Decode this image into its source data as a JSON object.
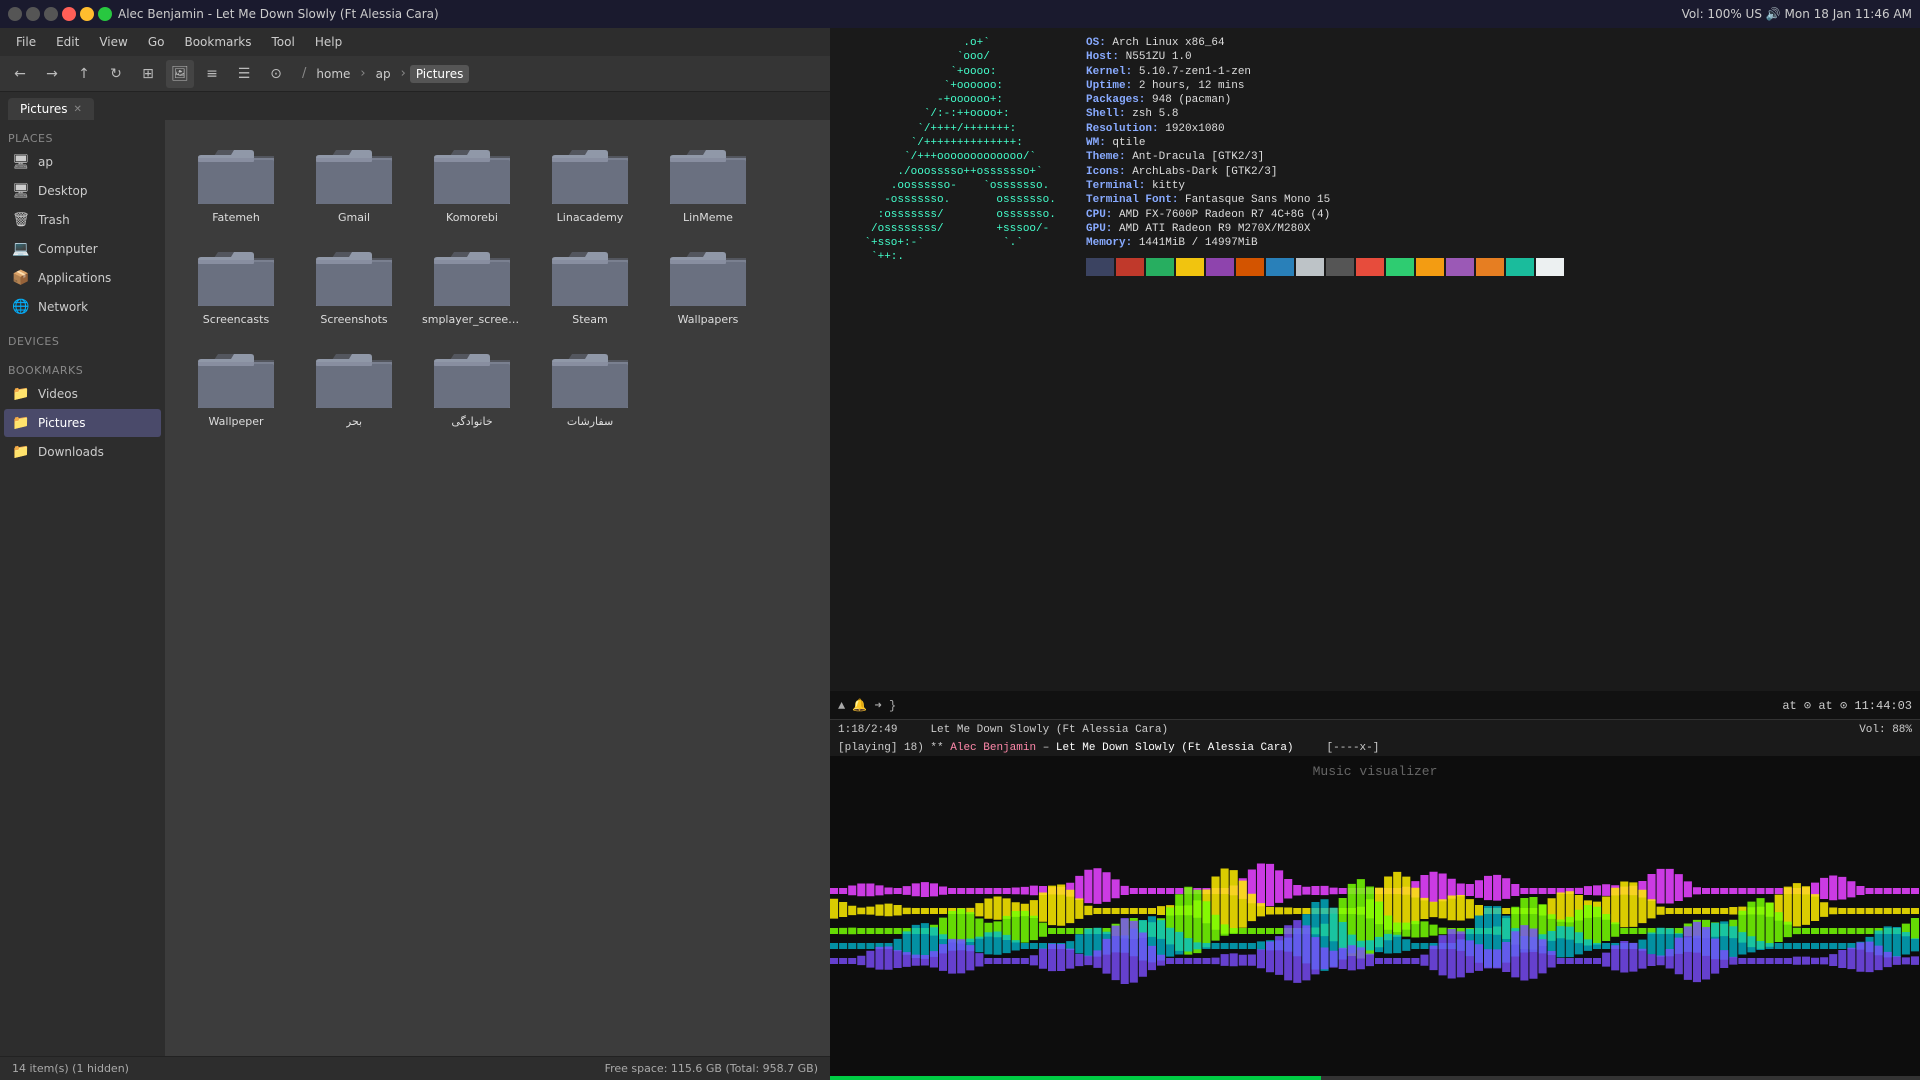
{
  "titlebar": {
    "title": "Alec Benjamin - Let Me Down Slowly (Ft Alessia Cara)",
    "right": "Vol: 100%  US 🔊  Mon 18 Jan  11:46 AM",
    "dots": [
      "#ff5f57",
      "#ffbd2e",
      "#28c840"
    ]
  },
  "menubar": {
    "items": [
      "File",
      "Edit",
      "View",
      "Go",
      "Bookmarks",
      "Tool",
      "Help"
    ]
  },
  "toolbar": {
    "buttons": [
      "←",
      "→",
      "↑",
      "↻",
      "⊞",
      "🖼",
      "≡",
      "☰",
      "⊡"
    ],
    "breadcrumb": [
      "/",
      "home",
      "ap",
      "Pictures"
    ]
  },
  "tabs": [
    {
      "label": "Pictures",
      "active": true
    }
  ],
  "sidebar": {
    "places_title": "Places",
    "places": [
      {
        "label": "ap",
        "icon": "🖥"
      },
      {
        "label": "Desktop",
        "icon": "🖥"
      },
      {
        "label": "Trash",
        "icon": "🗑"
      },
      {
        "label": "Computer",
        "icon": "💻"
      },
      {
        "label": "Applications",
        "icon": "📦"
      },
      {
        "label": "Network",
        "icon": "🌐"
      }
    ],
    "devices_title": "Devices",
    "bookmarks_title": "Bookmarks",
    "bookmarks": [
      {
        "label": "Videos",
        "icon": "📁",
        "active": false
      },
      {
        "label": "Pictures",
        "icon": "📁",
        "active": true
      },
      {
        "label": "Downloads",
        "icon": "📁"
      }
    ]
  },
  "folders": [
    {
      "name": "Fatemeh"
    },
    {
      "name": "Gmail"
    },
    {
      "name": "Komorebi"
    },
    {
      "name": "Linacademy"
    },
    {
      "name": "LinMeme"
    },
    {
      "name": "Screencasts"
    },
    {
      "name": "Screenshots"
    },
    {
      "name": "smplayer_screenshot"
    },
    {
      "name": "Steam"
    },
    {
      "name": "Wallpapers"
    },
    {
      "name": "Wallpeper"
    },
    {
      "name": "بحر"
    },
    {
      "name": "خانوادگی"
    },
    {
      "name": "سفارشات"
    }
  ],
  "statusbar": {
    "items": "14 item(s) (1 hidden)",
    "space": "Free space: 115.6 GB (Total: 958.7 GB)"
  },
  "neofetch": {
    "art": "                   .o+`\n                  `ooo/\n                 `+oooo:\n                `+oooooo:\n               -+oooooo+:\n             `/:-:++oooo+:\n            `/++++/+++++++:\n           `/++++++++++++++:\n          `/+++ooooooooooooo/`\n         ./ooosssso++osssssso+`\n        .oossssso-    `osssssso.\n       -osssssso.       osssssso.\n      :osssssss/        osssssso.\n     /ossssssss/        +sssoo/-\n    `+sso+:-`            `.`\n     `++:.",
    "info": [
      {
        "key": "OS:",
        "val": " Arch Linux x86_64"
      },
      {
        "key": "Host:",
        "val": " N551ZU 1.0"
      },
      {
        "key": "Kernel:",
        "val": " 5.10.7-zen1-1-zen"
      },
      {
        "key": "Uptime:",
        "val": " 2 hours, 12 mins"
      },
      {
        "key": "Packages:",
        "val": " 948 (pacman)"
      },
      {
        "key": "Shell:",
        "val": " zsh 5.8"
      },
      {
        "key": "Resolution:",
        "val": " 1920x1080"
      },
      {
        "key": "WM:",
        "val": " qtile"
      },
      {
        "key": "Theme:",
        "val": " Ant-Dracula [GTK2/3]"
      },
      {
        "key": "Icons:",
        "val": " ArchLabs-Dark [GTK2/3]"
      },
      {
        "key": "Terminal:",
        "val": " kitty"
      },
      {
        "key": "Terminal Font:",
        "val": " Fantasque Sans Mono 15"
      },
      {
        "key": "CPU:",
        "val": " AMD FX-7600P Radeon R7 4C+8G (4)"
      },
      {
        "key": "GPU:",
        "val": " AMD ATI Radeon R9 M270X/M280X"
      },
      {
        "key": "Memory:",
        "val": " 1441MiB / 14997MiB"
      }
    ],
    "colors": [
      "#3b4361",
      "#c0392b",
      "#27ae60",
      "#f1c40f",
      "#8e44ad",
      "#d35400",
      "#2980b9",
      "#bdc3c7",
      "#555",
      "#e74c3c",
      "#2ecc71",
      "#f39c12",
      "#9b59b6",
      "#e67e22",
      "#1abc9c",
      "#ecf0f1"
    ]
  },
  "prompt": {
    "text": "▲ 🔔  > }",
    "time": "at ⊙ 11:44:03"
  },
  "music": {
    "time_current": "1:18",
    "time_total": "2:49",
    "title": "Let Me Down Slowly (Ft Alessia Cara)",
    "volume": "Vol: 88%",
    "status": "playing",
    "track_num": "18",
    "artist": "Alec Benjamin",
    "full_title": "Let Me Down Slowly (Ft Alessia Cara)",
    "mode": "[----x-]",
    "visualizer_label": "Music visualizer",
    "progress_pct": 45
  }
}
